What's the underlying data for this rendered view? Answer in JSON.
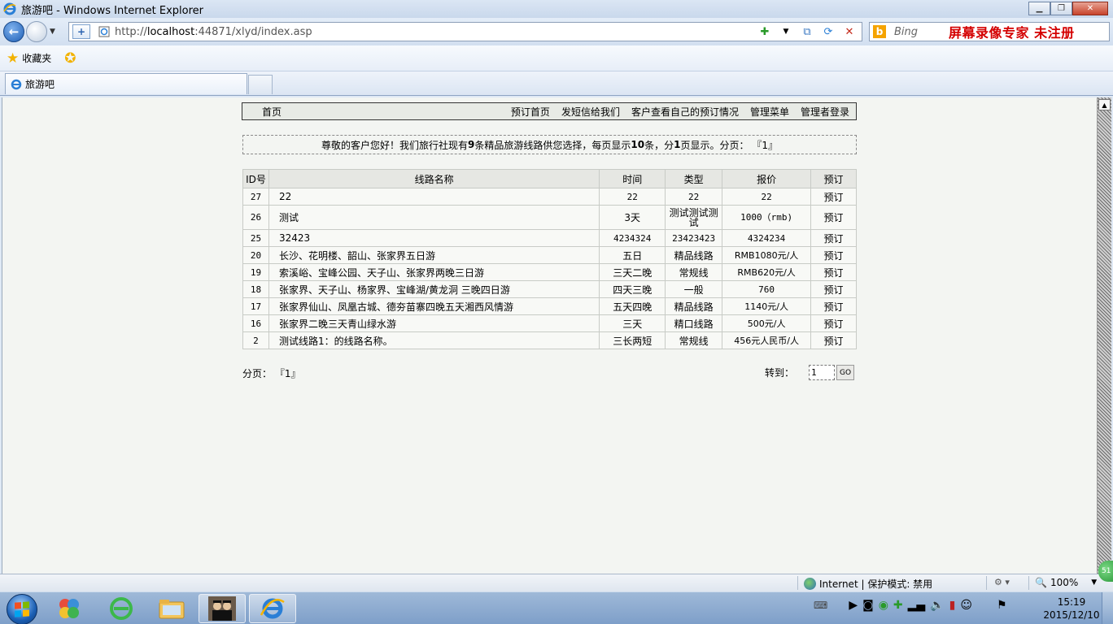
{
  "window": {
    "title": "旅游吧 - Windows Internet Explorer",
    "minimize": "▁",
    "restore": "❐",
    "close": "✕"
  },
  "address_bar": {
    "url_prefix": "http://",
    "url_host": "localhost",
    "url_rest": ":44871/xlyd/index.asp",
    "search_placeholder": "Bing"
  },
  "overlay_watermark": "屏幕录像专家  未注册",
  "favorites": {
    "label": "收藏夹"
  },
  "tabs": [
    {
      "label": "旅游吧"
    }
  ],
  "site_nav": {
    "home": "首页",
    "links": [
      "预订首页",
      "发短信给我们",
      "客户查看自己的预订情况",
      "管理菜单",
      "管理者登录"
    ]
  },
  "notice": {
    "prefix": "尊敬的客户您好！我们旅行社现有",
    "count": "9",
    "middle": "条精品旅游线路供您选择，每页显示",
    "per_page": "10",
    "middle2": "条，分",
    "pages": "1",
    "suffix": "页显示。分页：  『1』"
  },
  "table": {
    "headers": [
      "ID号",
      "线路名称",
      "时间",
      "类型",
      "报价",
      "预订"
    ],
    "rows": [
      {
        "id": "27",
        "name": "22",
        "time": "22",
        "type": "22",
        "price": "22",
        "action": "预订"
      },
      {
        "id": "26",
        "name": "测试",
        "time": "3天",
        "type": "测试测试测试",
        "price": "1000（rmb)",
        "action": "预订"
      },
      {
        "id": "25",
        "name": "32423",
        "time": "4234324",
        "type": "23423423",
        "price": "4324234",
        "action": "预订"
      },
      {
        "id": "20",
        "name": "长沙、花明楼、韶山、张家界五日游",
        "time": "五日",
        "type": "精品线路",
        "price": "RMB1080元/人",
        "action": "预订"
      },
      {
        "id": "19",
        "name": "索溪峪、宝峰公园、天子山、张家界两晚三日游",
        "time": "三天二晚",
        "type": "常规线",
        "price": "RMB620元/人",
        "action": "预订"
      },
      {
        "id": "18",
        "name": "张家界、天子山、杨家界、宝峰湖/黄龙洞 三晚四日游",
        "time": "四天三晚",
        "type": "一般",
        "price": "760",
        "action": "预订"
      },
      {
        "id": "17",
        "name": "张家界仙山、凤凰古城、德夯苗寨四晚五天湘西风情游",
        "time": "五天四晚",
        "type": "精品线路",
        "price": "1140元/人",
        "action": "预订"
      },
      {
        "id": "16",
        "name": "张家界二晚三天青山绿水游",
        "time": "三天",
        "type": "精口线路",
        "price": "500元/人",
        "action": "预订"
      },
      {
        "id": "2",
        "name": "测试线路1：的线路名称。",
        "time": "三长两短",
        "type": "常规线",
        "price": "456元人民币/人",
        "action": "预订"
      }
    ]
  },
  "pager": {
    "label": "分页：  『1』",
    "goto_label": "转到：",
    "goto_value": "1",
    "go_button": "GO"
  },
  "status_bar": {
    "zone": "Internet | 保护模式: 禁用",
    "zoom": "100%"
  },
  "taskbar": {
    "time": "15:19",
    "date": "2015/12/10",
    "badge": "51"
  }
}
